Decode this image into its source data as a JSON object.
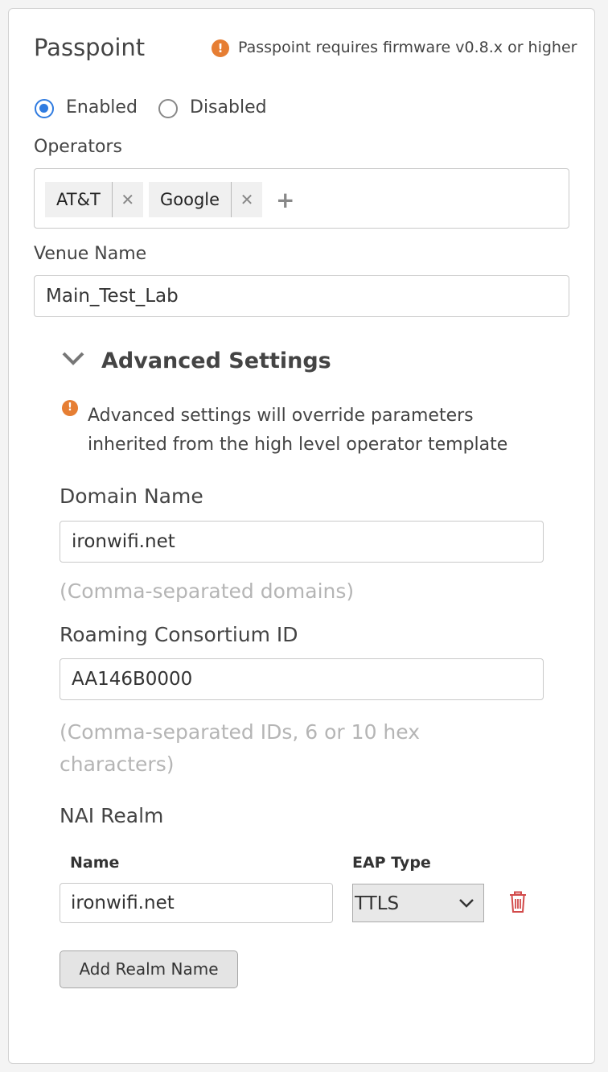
{
  "passpoint": {
    "title": "Passpoint",
    "firmware_note": "Passpoint requires firmware v0.8.x or higher",
    "status": {
      "enabled_label": "Enabled",
      "disabled_label": "Disabled",
      "selected": "Enabled"
    },
    "operators": {
      "label": "Operators",
      "chips": [
        "AT&T",
        "Google"
      ]
    },
    "venue": {
      "label": "Venue Name",
      "value": "Main_Test_Lab"
    }
  },
  "advanced": {
    "title": "Advanced Settings",
    "warning": [
      "Advanced settings will override parameters",
      "inherited from the high level operator template"
    ],
    "domain": {
      "label": "Domain Name",
      "value": "ironwifi.net",
      "hint": "(Comma-separated domains)"
    },
    "roaming": {
      "label": "Roaming Consortium ID",
      "value": "AA146B0000",
      "hint": [
        "(Comma-separated IDs, 6 or 10 hex",
        "characters)"
      ]
    },
    "nai": {
      "label": "NAI Realm",
      "name_header": "Name",
      "eap_header": "EAP Type",
      "realm_name": "ironwifi.net",
      "eap_value": "TTLS",
      "add_button": "Add Realm Name"
    }
  },
  "colors": {
    "accent": "#2f7be0",
    "warning": "#e67e33",
    "delete": "#d24a4a"
  }
}
